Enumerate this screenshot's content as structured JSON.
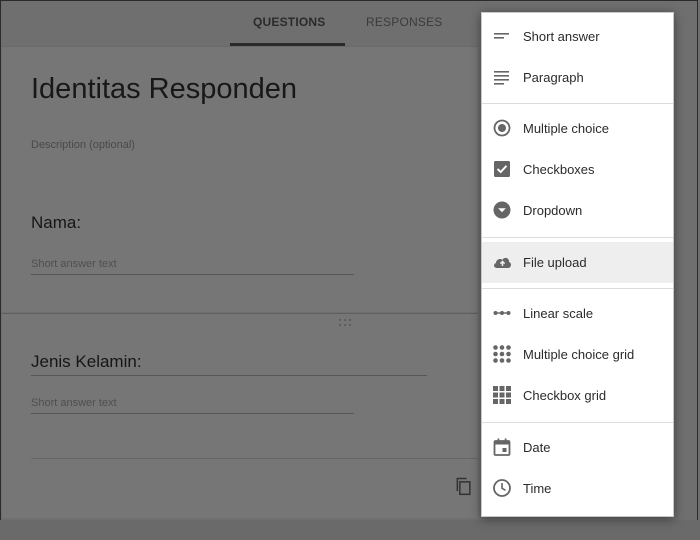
{
  "tabs": {
    "questions": "QUESTIONS",
    "responses": "RESPONSES"
  },
  "form": {
    "title": "Identitas Responden",
    "description_placeholder": "Description (optional)"
  },
  "questions": [
    {
      "title": "Nama:",
      "answer_placeholder": "Short answer text"
    },
    {
      "title": "Jenis Kelamin:",
      "answer_placeholder": "Short answer text"
    }
  ],
  "menu": {
    "items": [
      {
        "label": "Short answer",
        "icon": "short-answer-icon"
      },
      {
        "label": "Paragraph",
        "icon": "paragraph-icon"
      },
      {
        "label": "Multiple choice",
        "icon": "radio-button-icon"
      },
      {
        "label": "Checkboxes",
        "icon": "checkbox-icon"
      },
      {
        "label": "Dropdown",
        "icon": "dropdown-icon"
      },
      {
        "label": "File upload",
        "icon": "cloud-upload-icon",
        "highlighted": true
      },
      {
        "label": "Linear scale",
        "icon": "linear-scale-icon"
      },
      {
        "label": "Multiple choice grid",
        "icon": "dot-grid-icon"
      },
      {
        "label": "Checkbox grid",
        "icon": "square-grid-icon"
      },
      {
        "label": "Date",
        "icon": "calendar-icon"
      },
      {
        "label": "Time",
        "icon": "clock-icon"
      }
    ]
  },
  "colors": {
    "overlay": "#6f6f6f",
    "menu_bg": "#ffffff",
    "highlight": "#eeeeee",
    "icon": "#666666"
  }
}
